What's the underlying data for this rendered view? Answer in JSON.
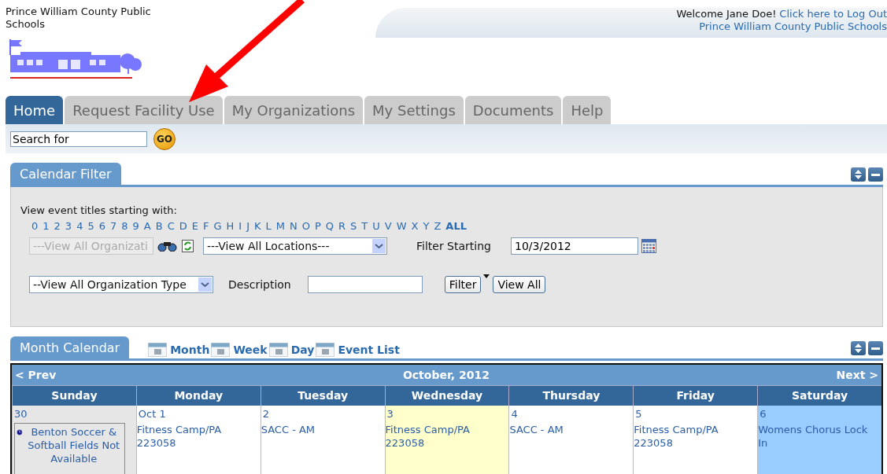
{
  "header": {
    "org_name": "Prince William County Public Schools",
    "welcome": "Welcome Jane Doe!",
    "logout_link": "Click here to Log Out",
    "org_link": "Prince William County Public Schools"
  },
  "tabs": [
    {
      "label": "Home",
      "selected": true
    },
    {
      "label": "Request Facility Use",
      "selected": false
    },
    {
      "label": "My Organizations",
      "selected": false
    },
    {
      "label": "My Settings",
      "selected": false
    },
    {
      "label": "Documents",
      "selected": false
    },
    {
      "label": "Help",
      "selected": false
    }
  ],
  "search": {
    "value": "Search for",
    "button": "GO"
  },
  "filter_panel": {
    "title": "Calendar Filter",
    "letters_label": "View event titles starting with:",
    "letters": [
      "0",
      "1",
      "2",
      "3",
      "4",
      "5",
      "6",
      "7",
      "8",
      "9",
      "A",
      "B",
      "C",
      "D",
      "E",
      "F",
      "G",
      "H",
      "I",
      "J",
      "K",
      "L",
      "M",
      "N",
      "O",
      "P",
      "Q",
      "R",
      "S",
      "T",
      "U",
      "V",
      "W",
      "X",
      "Y",
      "Z"
    ],
    "all_label": "ALL",
    "organization": {
      "value": "---View All Organizati",
      "disabled": true
    },
    "location": {
      "value": "---View All Locations---"
    },
    "filter_starting_label": "Filter Starting",
    "filter_starting": "10/3/2012",
    "org_type": {
      "value": "--View All Organization Type"
    },
    "description_label": "Description",
    "filter_button": "Filter",
    "view_all_button": "View All"
  },
  "calendar_panel": {
    "title": "Month Calendar",
    "views": [
      {
        "label": "Month"
      },
      {
        "label": "Week"
      },
      {
        "label": "Day"
      },
      {
        "label": "Event List"
      }
    ],
    "prev": "< Prev",
    "month_title": "October, 2012",
    "next": "Next >",
    "weekdays": [
      "Sunday",
      "Monday",
      "Tuesday",
      "Wednesday",
      "Thursday",
      "Friday",
      "Saturday"
    ],
    "days": [
      {
        "date": "30",
        "kind": "other-month",
        "events": [
          {
            "kind": "blocked",
            "text": "Benton Soccer & Softball Fields Not Available"
          }
        ]
      },
      {
        "date": "Oct 1",
        "kind": "normal",
        "events": [
          {
            "kind": "event",
            "text": "Fitness Camp/PA 223058"
          }
        ]
      },
      {
        "date": "2",
        "kind": "normal",
        "events": [
          {
            "kind": "event",
            "text": "SACC - AM"
          }
        ]
      },
      {
        "date": "3",
        "kind": "today",
        "events": [
          {
            "kind": "event",
            "text": "Fitness Camp/PA 223058"
          }
        ]
      },
      {
        "date": "4",
        "kind": "normal",
        "events": [
          {
            "kind": "event",
            "text": "SACC - AM"
          }
        ]
      },
      {
        "date": "5",
        "kind": "normal",
        "events": [
          {
            "kind": "event",
            "text": "Fitness Camp/PA 223058"
          }
        ]
      },
      {
        "date": "6",
        "kind": "weekend",
        "events": [
          {
            "kind": "event",
            "text": "Womens Chorus Lock In"
          }
        ]
      }
    ]
  }
}
